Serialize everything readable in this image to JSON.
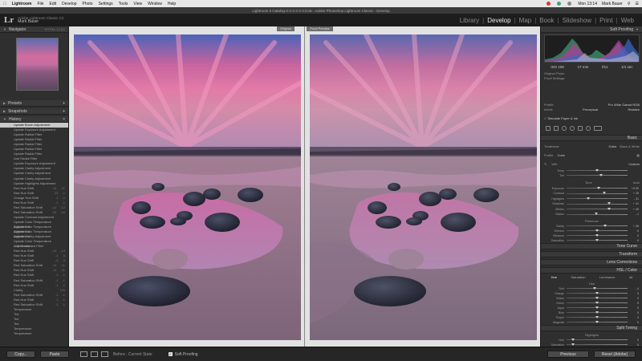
{
  "menubar": {
    "app": "Lightroom",
    "items": [
      "File",
      "Edit",
      "Develop",
      "Photo",
      "Settings",
      "Tools",
      "View",
      "Window",
      "Help"
    ],
    "clock": "Mon 13:14",
    "user": "Mark Bauer"
  },
  "window_title": "Lightroom 5 Catalog-2-2-2-2-2-2.lrcat - Adobe Photoshop Lightroom Classic - Develop",
  "identity": {
    "line1": "Adobe Lightroom Classic CC",
    "line2": "Mark Bauer"
  },
  "modules": [
    {
      "label": "Library",
      "active": false
    },
    {
      "label": "Develop",
      "active": true
    },
    {
      "label": "Map",
      "active": false
    },
    {
      "label": "Book",
      "active": false
    },
    {
      "label": "Slideshow",
      "active": false
    },
    {
      "label": "Print",
      "active": false
    },
    {
      "label": "Web",
      "active": false
    }
  ],
  "left_panel": {
    "navigator": {
      "title": "Navigator",
      "zoom": "FIT  FILL  1:1  3:1"
    },
    "presets": "Presets",
    "snapshots": "Snapshots",
    "history_title": "History",
    "history": [
      {
        "label": "Update Brush Adjustment",
        "v1": "",
        "v2": ""
      },
      {
        "label": "Update Exposure Adjustment",
        "v1": "",
        "v2": ""
      },
      {
        "label": "Update Radial Filter",
        "v1": "",
        "v2": ""
      },
      {
        "label": "Update Radial Filter",
        "v1": "",
        "v2": ""
      },
      {
        "label": "Update Radial Filter",
        "v1": "",
        "v2": ""
      },
      {
        "label": "Update Radial Filter",
        "v1": "",
        "v2": ""
      },
      {
        "label": "Update Radial Filter",
        "v1": "",
        "v2": ""
      },
      {
        "label": "Add Radial Filter",
        "v1": "",
        "v2": ""
      },
      {
        "label": "Update Exposure Adjustment",
        "v1": "",
        "v2": ""
      },
      {
        "label": "Update Clarity Adjustment",
        "v1": "",
        "v2": ""
      },
      {
        "label": "Update Clarity Adjustment",
        "v1": "",
        "v2": ""
      },
      {
        "label": "Update Clarity Adjustment",
        "v1": "",
        "v2": ""
      },
      {
        "label": "Update Highlights Adjustment",
        "v1": "",
        "v2": ""
      },
      {
        "label": "Red Hue Shift",
        "v1": "-11",
        "v2": "-11"
      },
      {
        "label": "Red Hue Shift",
        "v1": "-11",
        "v2": "-1"
      },
      {
        "label": "Orange Hue Shift",
        "v1": "-1",
        "v2": "-1"
      },
      {
        "label": "Red Hue Shift",
        "v1": "-1",
        "v2": "-1"
      },
      {
        "label": "Red Saturation Shift",
        "v1": "-12",
        "v2": "-12"
      },
      {
        "label": "Red Saturation Shift",
        "v1": "-10",
        "v2": "-10"
      },
      {
        "label": "Update Contrast Adjustment",
        "v1": "",
        "v2": ""
      },
      {
        "label": "Update Color Temperature Adjustment",
        "v1": "",
        "v2": ""
      },
      {
        "label": "Update Color Temperature Adjustment",
        "v1": "",
        "v2": ""
      },
      {
        "label": "Update Color Temperature Adjustment",
        "v1": "",
        "v2": ""
      },
      {
        "label": "Update Clarity Adjustment",
        "v1": "",
        "v2": ""
      },
      {
        "label": "Update Color Temperature Adjustment",
        "v1": "",
        "v2": ""
      },
      {
        "label": "Add Graduated Filter",
        "v1": "",
        "v2": ""
      },
      {
        "label": "Red Hue Shift",
        "v1": "-13",
        "v2": "-13"
      },
      {
        "label": "Red Hue Shift",
        "v1": "-4",
        "v2": "-4"
      },
      {
        "label": "Red Hue Shift",
        "v1": "-3",
        "v2": "-3"
      },
      {
        "label": "Red Saturation Shift",
        "v1": "-11",
        "v2": "-11"
      },
      {
        "label": "Red Hue Shift",
        "v1": "-11",
        "v2": "-11"
      },
      {
        "label": "Red Hue Shift",
        "v1": "-1",
        "v2": "-1"
      },
      {
        "label": "Red Saturation Shift",
        "v1": "-1",
        "v2": "-1"
      },
      {
        "label": "Red Hue Shift",
        "v1": "-1",
        "v2": "-1"
      },
      {
        "label": "Clarity",
        "v1": "",
        "v2": "+26"
      },
      {
        "label": "Red Saturation Shift",
        "v1": "-1",
        "v2": "-1"
      },
      {
        "label": "Red Hue Shift",
        "v1": "-1",
        "v2": "-1"
      },
      {
        "label": "Red Saturation Shift",
        "v1": "-1",
        "v2": "-1"
      },
      {
        "label": "Temperature",
        "v1": "",
        "v2": ""
      },
      {
        "label": "Tint",
        "v1": "",
        "v2": ""
      },
      {
        "label": "Tint",
        "v1": "",
        "v2": ""
      },
      {
        "label": "Tint",
        "v1": "",
        "v2": ""
      },
      {
        "label": "Temperature",
        "v1": "",
        "v2": ""
      },
      {
        "label": "Temperature",
        "v1": "",
        "v2": ""
      }
    ],
    "history_selected_index": 0,
    "copy_label": "Copy...",
    "paste_label": "Paste"
  },
  "center": {
    "before_label": "Original",
    "after_label": "Proof Preview"
  },
  "right_panel": {
    "soft_proofing": "Soft Proofing",
    "exif": [
      "ISO 100",
      "17 mm",
      "f/11",
      "1/1 sec"
    ],
    "original_photo": "Original Photo",
    "proof_settings": "Proof Settings:",
    "profile_label": "Profile:",
    "profile_value": "Pro Wide Gamut RGB",
    "intent_label": "Intent:",
    "intent_perceptual": "Perceptual",
    "intent_relative": "Relative",
    "simulate_paper": "Simulate Paper & Ink",
    "basic": "Basic",
    "treatment_label": "Treatment:",
    "treatment_color": "Color",
    "treatment_bw": "Black & White",
    "profile2_label": "Profile:",
    "profile2_value": "Color",
    "wb_label": "WB:",
    "wb_value": "Custom",
    "tone_label": "Tone",
    "tone_auto": "Auto",
    "presence_label": "Presence",
    "sliders_top": [
      {
        "label": "Temp",
        "value": "",
        "pos": 0.5
      },
      {
        "label": "Tint",
        "value": "",
        "pos": 0.56
      }
    ],
    "sliders_tone": [
      {
        "label": "Exposure",
        "value": "+0.30",
        "pos": 0.53
      },
      {
        "label": "Contrast",
        "value": "+ 25",
        "pos": 0.62
      },
      {
        "label": "Highlights",
        "value": "- 31",
        "pos": 0.35
      },
      {
        "label": "Shadows",
        "value": "+ 41",
        "pos": 0.7
      },
      {
        "label": "Whites",
        "value": "+ 40",
        "pos": 0.7
      },
      {
        "label": "Blacks",
        "value": "- 1",
        "pos": 0.49
      }
    ],
    "sliders_presence": [
      {
        "label": "Clarity",
        "value": "+ 26",
        "pos": 0.63
      },
      {
        "label": "Dehaze",
        "value": "0",
        "pos": 0.5
      },
      {
        "label": "Vibrance",
        "value": "0",
        "pos": 0.5
      },
      {
        "label": "Saturation",
        "value": "0",
        "pos": 0.5
      }
    ],
    "tone_curve": "Tone Curve",
    "transform": "Transform",
    "lens_corrections": "Lens Corrections",
    "hsl": "HSL / Color",
    "hsl_tabs": [
      "Hue",
      "Saturation",
      "Luminance",
      "All"
    ],
    "hsl_heading": "Hue",
    "sliders_hsl": [
      {
        "label": "Red",
        "value": "- 4",
        "pos": 0.46
      },
      {
        "label": "Orange",
        "value": "0",
        "pos": 0.5
      },
      {
        "label": "Yellow",
        "value": "0",
        "pos": 0.5
      },
      {
        "label": "Green",
        "value": "0",
        "pos": 0.5
      },
      {
        "label": "Aqua",
        "value": "0",
        "pos": 0.5
      },
      {
        "label": "Blue",
        "value": "0",
        "pos": 0.5
      },
      {
        "label": "Purple",
        "value": "0",
        "pos": 0.5
      },
      {
        "label": "Magenta",
        "value": "0",
        "pos": 0.5
      }
    ],
    "split_toning": "Split Toning",
    "highlights_label": "Highlights",
    "shadows_label": "Shadows",
    "balance_label": "Balance",
    "sliders_split_hi": [
      {
        "label": "Hue",
        "value": "0",
        "pos": 0.1
      },
      {
        "label": "Saturation",
        "value": "0",
        "pos": 0.1
      }
    ],
    "sliders_split_bal": [
      {
        "label": "Balance",
        "value": "0",
        "pos": 0.5
      }
    ],
    "sliders_split_sh": [
      {
        "label": "Hue",
        "value": "0",
        "pos": 0.1
      },
      {
        "label": "Saturation",
        "value": "0",
        "pos": 0.1
      }
    ],
    "previous_label": "Previous",
    "reset_label": "Reset (Adobe)"
  },
  "toolbar": {
    "before_after_label": "Before : Current State",
    "soft_proofing_label": "Soft Proofing",
    "soft_proofing_checked": true
  }
}
